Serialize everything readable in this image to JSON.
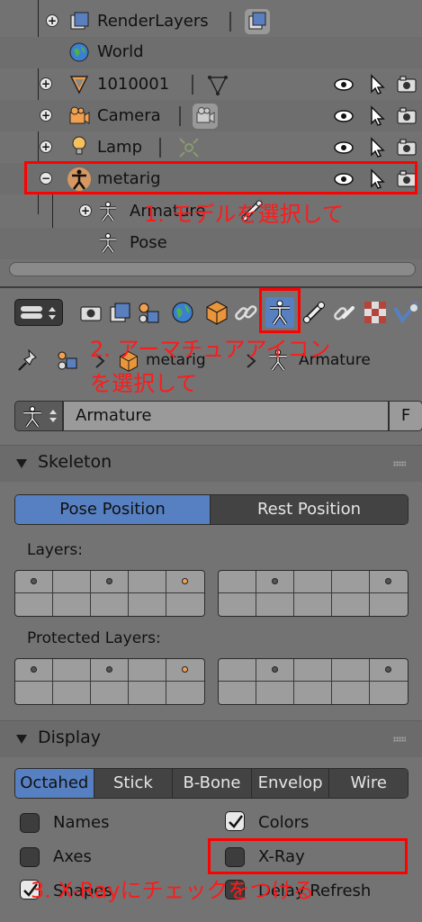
{
  "outliner": {
    "rows": [
      {
        "label": "RenderLayers",
        "expander": "+"
      },
      {
        "label": "World",
        "expander": ""
      },
      {
        "label": "1010001",
        "expander": "+"
      },
      {
        "label": "Camera",
        "expander": "+"
      },
      {
        "label": "Lamp",
        "expander": "+"
      },
      {
        "label": "metarig",
        "expander": "−"
      },
      {
        "label": "Armature",
        "expander": "+"
      },
      {
        "label": "Pose",
        "expander": ""
      }
    ]
  },
  "annotations": {
    "step1": "1. モデルを選択して",
    "step2_line1": "2. アーマチュアアイコン",
    "step2_line2": "を選択して",
    "step3": "3. X-Rayにチェックをつける"
  },
  "properties": {
    "breadcrumb": {
      "object": "metarig",
      "data": "Armature"
    },
    "datablock": {
      "name": "Armature",
      "fake_user": "F"
    },
    "skeleton": {
      "title": "Skeleton",
      "position_modes": [
        "Pose Position",
        "Rest Position"
      ],
      "selected_mode": "Pose Position",
      "layers_label": "Layers:",
      "protected_label": "Protected Layers:"
    },
    "display": {
      "title": "Display",
      "modes": [
        "Octahed",
        "Stick",
        "B-Bone",
        "Envelop",
        "Wire"
      ],
      "selected_mode": "Octahed",
      "options": {
        "names": {
          "label": "Names",
          "checked": false
        },
        "colors": {
          "label": "Colors",
          "checked": true
        },
        "axes": {
          "label": "Axes",
          "checked": false
        },
        "xray": {
          "label": "X-Ray",
          "checked": false
        },
        "shapes": {
          "label": "Shapes",
          "checked": true
        },
        "delay_refresh": {
          "label": "Delay Refresh",
          "checked": false
        }
      }
    }
  },
  "colors": {
    "accent": "#5680c2",
    "highlight": "#ff0000",
    "active_layer": "#f0a050"
  }
}
